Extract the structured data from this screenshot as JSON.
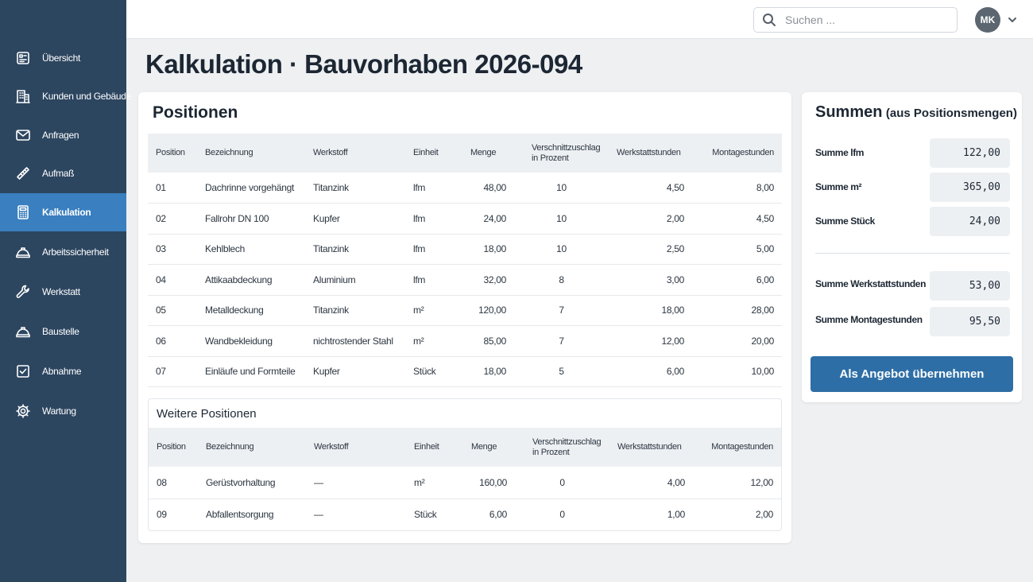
{
  "sidebar": {
    "items": [
      {
        "label": "Übersicht",
        "icon": "overview-icon"
      },
      {
        "label": "Kunden und Gebäude",
        "icon": "building-icon"
      },
      {
        "label": "Anfragen",
        "icon": "mail-icon"
      },
      {
        "label": "Aufmaß",
        "icon": "ruler-icon"
      },
      {
        "label": "Kalkulation",
        "icon": "calculator-icon",
        "active": true
      },
      {
        "label": "Arbeitssicherheit",
        "icon": "helmet-icon"
      },
      {
        "label": "Werkstatt",
        "icon": "wrench-icon"
      },
      {
        "label": "Baustelle",
        "icon": "helmet-icon"
      },
      {
        "label": "Abnahme",
        "icon": "checkbox-icon"
      },
      {
        "label": "Wartung",
        "icon": "gear-icon"
      }
    ]
  },
  "topbar": {
    "search_placeholder": "Suchen ...",
    "avatar_initials": "MK"
  },
  "page": {
    "title": "Kalkulation · Bauvorhaben 2026-094"
  },
  "positions": {
    "title": "Positionen",
    "headers": [
      "Position",
      "Bezeichnung",
      "Werkstoff",
      "Einheit",
      "Menge",
      "Verschnittzuschlag in Prozent",
      "Werkstattstunden",
      "Montagestunden"
    ],
    "rows": [
      [
        "01",
        "Dachrinne vorgehängt",
        "Titanzink",
        "lfm",
        "48,00",
        "10",
        "4,50",
        "8,00"
      ],
      [
        "02",
        "Fallrohr DN 100",
        "Kupfer",
        "lfm",
        "24,00",
        "10",
        "2,00",
        "4,50"
      ],
      [
        "03",
        "Kehlblech",
        "Titanzink",
        "lfm",
        "18,00",
        "10",
        "2,50",
        "5,00"
      ],
      [
        "04",
        "Attikaabdeckung",
        "Aluminium",
        "lfm",
        "32,00",
        "8",
        "3,00",
        "6,00"
      ],
      [
        "05",
        "Metalldeckung",
        "Titanzink",
        "m²",
        "120,00",
        "7",
        "18,00",
        "28,00"
      ],
      [
        "06",
        "Wandbekleidung",
        "nichtrostender Stahl",
        "m²",
        "85,00",
        "7",
        "12,00",
        "20,00"
      ],
      [
        "07",
        "Einläufe und Formteile",
        "Kupfer",
        "Stück",
        "18,00",
        "5",
        "6,00",
        "10,00"
      ]
    ]
  },
  "further_positions": {
    "title": "Weitere Positionen",
    "headers": [
      "Position",
      "Bezeichnung",
      "Werkstoff",
      "Einheit",
      "Menge",
      "Verschnittzuschlag in Prozent",
      "Werkstattstunden",
      "Montagestunden"
    ],
    "rows": [
      [
        "08",
        "Gerüstvorhaltung",
        "—",
        "m²",
        "160,00",
        "0",
        "4,00",
        "12,00"
      ],
      [
        "09",
        "Abfallentsorgung",
        "—",
        "Stück",
        "6,00",
        "0",
        "1,00",
        "2,00"
      ]
    ]
  },
  "sums": {
    "title": "Summen",
    "subtitle": "(aus Positionsmengen)",
    "items": [
      {
        "label": "Summe lfm",
        "value": "122,00"
      },
      {
        "label": "Summe m²",
        "value": "365,00"
      },
      {
        "label": "Summe Stück",
        "value": "24,00"
      },
      {
        "label": "Summe Werkstattstunden",
        "value": "53,00"
      },
      {
        "label": "Summe Montagestunden",
        "value": "95,50"
      }
    ],
    "cta_label": "Als Angebot übernehmen"
  }
}
